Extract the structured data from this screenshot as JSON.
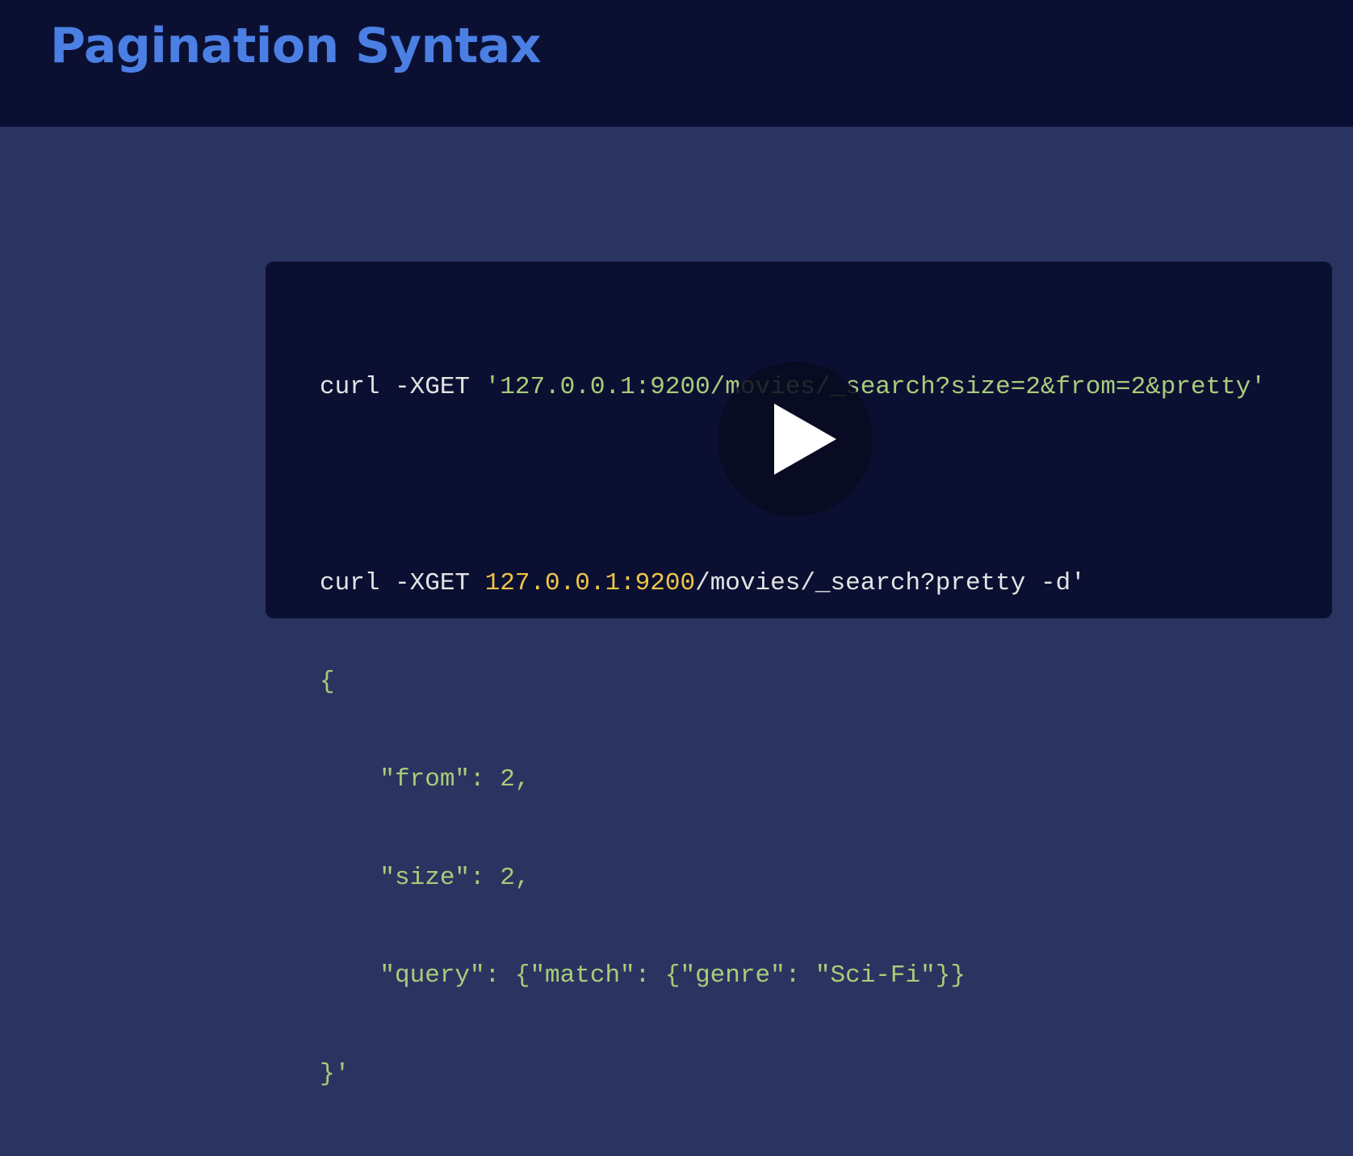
{
  "header": {
    "title": "Pagination Syntax"
  },
  "code": {
    "line1_cmd": "curl -XGET ",
    "line1_url": "'127.0.0.1:9200/movies/_search?size=2&from=2&pretty'",
    "line3_cmd": "curl -XGET ",
    "line3_host": "127.0.0.1:9200",
    "line3_path": "/movies/_search?pretty -d'",
    "line4": "{",
    "line5": "    \"from\": 2,",
    "line6": "    \"size\": 2,",
    "line7": "    \"query\": {\"match\": {\"genre\": \"Sci-Fi\"}}",
    "line8": "}'"
  },
  "player": {
    "icon": "play-icon"
  },
  "colors": {
    "header_bg": "#0b1033",
    "body_bg": "#2b3461",
    "title": "#4b7fe3",
    "string": "#a9cc7a",
    "number": "#f1c445"
  }
}
